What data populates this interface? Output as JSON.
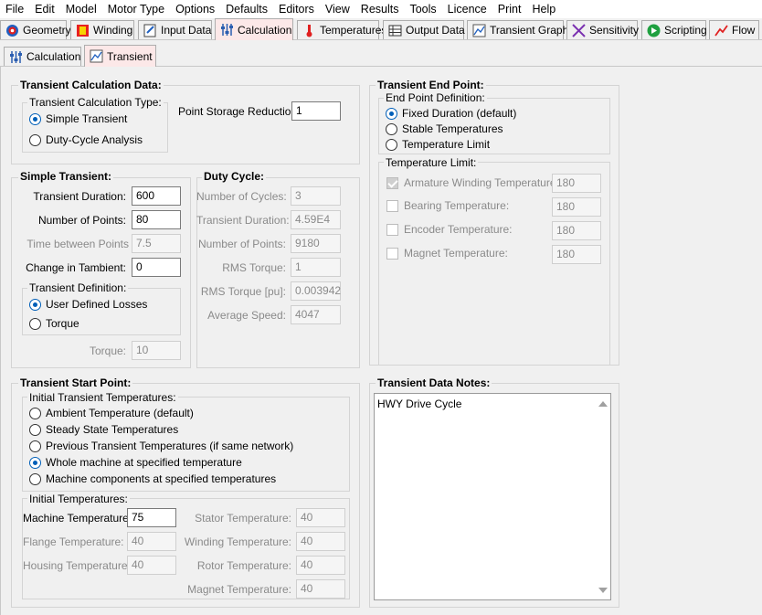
{
  "menu": [
    "File",
    "Edit",
    "Model",
    "Motor Type",
    "Options",
    "Defaults",
    "Editors",
    "View",
    "Results",
    "Tools",
    "Licence",
    "Print",
    "Help"
  ],
  "tabs": [
    "Geometry",
    "Winding",
    "Input Data",
    "Calculation",
    "Temperatures",
    "Output Data",
    "Transient Graph",
    "Sensitivity",
    "Scripting",
    "Flow"
  ],
  "active_tab": "Calculation",
  "subtabs": [
    "Calculation",
    "Transient"
  ],
  "active_subtab": "Transient",
  "transient_calc": {
    "title": "Transient Calculation Data:",
    "type_group": "Transient Calculation Type:",
    "options": [
      "Simple Transient",
      "Duty-Cycle Analysis"
    ],
    "selected": "Simple Transient",
    "point_storage_label": "Point Storage Reduction:",
    "point_storage_value": "1"
  },
  "simple_transient": {
    "title": "Simple Transient:",
    "duration_label": "Transient Duration:",
    "duration_value": "600",
    "points_label": "Number of Points:",
    "points_value": "80",
    "time_between_label": "Time between Points",
    "time_between_value": "7.5",
    "tambient_label": "Change in Tambient:",
    "tambient_value": "0",
    "definition_group": "Transient Definition:",
    "definition_options": [
      "User Defined Losses",
      "Torque"
    ],
    "definition_selected": "User Defined Losses",
    "torque_label": "Torque:",
    "torque_value": "10"
  },
  "duty_cycle": {
    "title": "Duty Cycle:",
    "rows": [
      {
        "label": "Number of Cycles:",
        "value": "3"
      },
      {
        "label": "Transient Duration:",
        "value": "4.59E4"
      },
      {
        "label": "Number of Points:",
        "value": "9180"
      },
      {
        "label": "RMS Torque:",
        "value": "1"
      },
      {
        "label": "RMS Torque [pu]:",
        "value": "0.003942"
      },
      {
        "label": "Average Speed:",
        "value": "4047"
      }
    ]
  },
  "end_point": {
    "title": "Transient End Point:",
    "def_group": "End Point Definition:",
    "options": [
      "Fixed Duration (default)",
      "Stable Temperatures",
      "Temperature Limit"
    ],
    "selected": "Fixed Duration (default)",
    "limit_group": "Temperature Limit:",
    "limits": [
      {
        "label": "Armature Winding Temperature:",
        "value": "180",
        "checked": true
      },
      {
        "label": "Bearing Temperature:",
        "value": "180",
        "checked": false
      },
      {
        "label": "Encoder Temperature:",
        "value": "180",
        "checked": false
      },
      {
        "label": "Magnet Temperature:",
        "value": "180",
        "checked": false
      }
    ]
  },
  "start_point": {
    "title": "Transient Start Point:",
    "init_group": "Initial Transient Temperatures:",
    "options": [
      "Ambient Temperature (default)",
      "Steady State Temperatures",
      "Previous Transient Temperatures (if same network)",
      "Whole machine at specified temperature",
      "Machine components at specified temperatures"
    ],
    "selected": "Whole machine at specified temperature",
    "temps_group": "Initial Temperatures:",
    "machine_label": "Machine Temperature:",
    "machine_value": "75",
    "flange_label": "Flange Temperature:",
    "flange_value": "40",
    "housing_label": "Housing Temperature:",
    "housing_value": "40",
    "stator_label": "Stator Temperature:",
    "stator_value": "40",
    "winding_label": "Winding Temperature:",
    "winding_value": "40",
    "rotor_label": "Rotor Temperature:",
    "rotor_value": "40",
    "magnet_label": "Magnet Temperature:",
    "magnet_value": "40"
  },
  "notes": {
    "title": "Transient Data Notes:",
    "text": "HWY Drive Cycle"
  },
  "colors": {
    "active_tab": "#fce8e8",
    "radio_on": "#005fb8"
  }
}
